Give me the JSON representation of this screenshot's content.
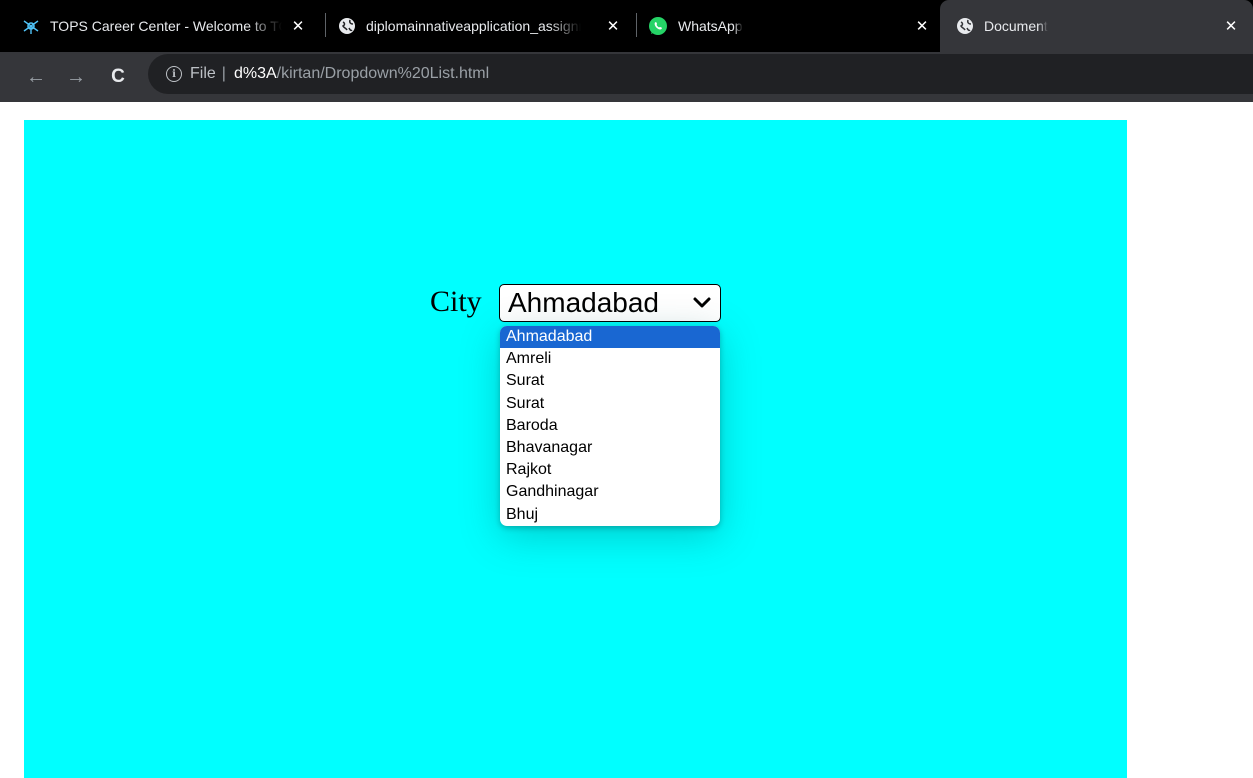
{
  "browser": {
    "tabs": [
      {
        "title": "TOPS Career Center - Welcome to TOPS",
        "icon": "tops-logo-icon",
        "active": false
      },
      {
        "title": "diplomainnativeapplication_assignment",
        "icon": "globe-icon",
        "active": false
      },
      {
        "title": "WhatsApp",
        "icon": "whatsapp-icon",
        "active": false
      },
      {
        "title": "Document",
        "icon": "globe-icon",
        "active": true
      }
    ],
    "close_glyph": "✕",
    "toolbar": {
      "back_glyph": "←",
      "forward_glyph": "→",
      "reload_glyph": "C"
    },
    "address": {
      "info_glyph": "i",
      "scheme": "File",
      "separator": "|",
      "host": "d%3A",
      "path": "/kirtan/Dropdown%20List.html"
    }
  },
  "page": {
    "background": "#00ffff",
    "label": "City",
    "select": {
      "selected": "Ahmadabad",
      "options": [
        "Ahmadabad",
        "Amreli",
        "Surat",
        "Surat",
        "Baroda",
        "Bhavanagar",
        "Rajkot",
        "Gandhinagar",
        "Bhuj"
      ],
      "selected_index": 0,
      "highlight_color": "#1967d2"
    }
  }
}
